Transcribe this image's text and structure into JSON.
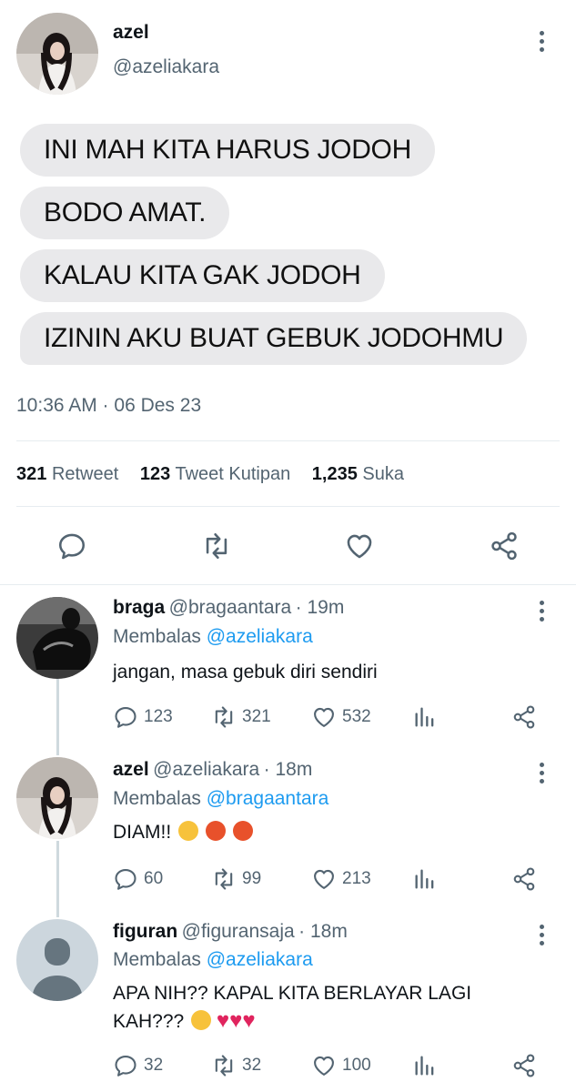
{
  "tweet": {
    "name": "azel",
    "handle": "@azeliakara",
    "bubbles": [
      "INI MAH KITA HARUS JODOH",
      "BODO AMAT.",
      "KALAU KITA GAK JODOH",
      "IZININ AKU BUAT GEBUK JODOHMU"
    ],
    "timestamp": "10:36 AM · 06 Des 23",
    "stats": {
      "retweets_count": "321",
      "retweets_label": "Retweet",
      "quotes_count": "123",
      "quotes_label": "Tweet Kutipan",
      "likes_count": "1,235",
      "likes_label": "Suka"
    }
  },
  "replies": [
    {
      "name": "braga",
      "handle": "@bragaantara",
      "time": "· 19m",
      "reply_prefix": "Membalas",
      "reply_to": "@azeliakara",
      "text": "jangan, masa gebuk diri sendiri",
      "replies": "123",
      "retweets": "321",
      "likes": "532"
    },
    {
      "name": "azel",
      "handle": "@azeliakara",
      "time": "· 18m",
      "reply_prefix": "Membalas",
      "reply_to": "@bragaantara",
      "text": "DIAM!!",
      "replies": "60",
      "retweets": "99",
      "likes": "213"
    },
    {
      "name": "figuran",
      "handle": "@figuransaja",
      "time": "· 18m",
      "reply_prefix": "Membalas",
      "reply_to": "@azeliakara",
      "text_line1": "APA NIH?? KAPAL KITA BERLAYAR LAGI",
      "text_line2": "KAH???",
      "replies": "32",
      "retweets": "32",
      "likes": "100"
    }
  ],
  "icons": {
    "reply": "reply-icon",
    "retweet": "retweet-icon",
    "like": "heart-icon",
    "share": "share-icon",
    "analytics": "analytics-icon",
    "more": "more-icon"
  },
  "colors": {
    "link": "#1d9bf0",
    "secondary": "#536471",
    "bubble": "#e9e9eb"
  }
}
